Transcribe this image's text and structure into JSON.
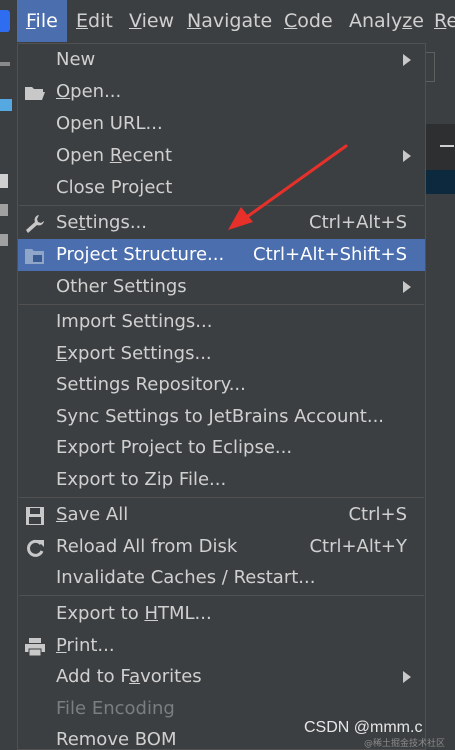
{
  "menubar": {
    "items": [
      {
        "id": "file",
        "mnemonic": "F",
        "rest": "ile"
      },
      {
        "id": "edit",
        "mnemonic": "E",
        "rest": "dit"
      },
      {
        "id": "view",
        "mnemonic": "V",
        "rest": "iew"
      },
      {
        "id": "navigate",
        "mnemonic": "N",
        "rest": "avigate"
      },
      {
        "id": "code",
        "mnemonic": "C",
        "rest": "ode"
      },
      {
        "id": "analyze",
        "pre": "Analy",
        "mnemonic": "z",
        "rest": "e"
      },
      {
        "id": "refactor",
        "mnemonic": "R",
        "rest": "e"
      }
    ],
    "active": "file"
  },
  "file_menu": {
    "items": [
      {
        "label": "New",
        "submenu": true
      },
      {
        "label": "Open...",
        "icon": "folder-open-icon"
      },
      {
        "label": "Open URL..."
      },
      {
        "label": "Open Recent",
        "submenu": true
      },
      {
        "label": "Close Project"
      },
      {
        "label": "Settings...",
        "shortcut": "Ctrl+Alt+S",
        "icon": "wrench-icon"
      },
      {
        "label": "Project Structure...",
        "shortcut": "Ctrl+Alt+Shift+S",
        "icon": "project-structure-icon",
        "selected": true
      },
      {
        "label": "Other Settings",
        "submenu": true
      },
      {
        "label": "Import Settings..."
      },
      {
        "label": "Export Settings..."
      },
      {
        "label": "Settings Repository..."
      },
      {
        "label": "Sync Settings to JetBrains Account..."
      },
      {
        "label": "Export Project to Eclipse..."
      },
      {
        "label": "Export to Zip File..."
      },
      {
        "label": "Save All",
        "shortcut": "Ctrl+S",
        "icon": "save-icon"
      },
      {
        "label": "Reload All from Disk",
        "shortcut": "Ctrl+Alt+Y",
        "icon": "reload-icon"
      },
      {
        "label": "Invalidate Caches / Restart..."
      },
      {
        "label": "Export to HTML..."
      },
      {
        "label": "Print...",
        "icon": "printer-icon"
      },
      {
        "label": "Add to Favorites",
        "submenu": true
      },
      {
        "label": "File Encoding",
        "disabled": true
      },
      {
        "label": "Remove BOM"
      }
    ]
  },
  "annotation": {
    "color": "#e8302a"
  },
  "watermark": {
    "text": "CSDN @mmm.c",
    "subtext": "@稀土掘金技术社区"
  },
  "colors": {
    "selection": "#4b6eaf",
    "menu_bg": "#3c3f41",
    "text": "#d0d0d0",
    "disabled": "#7b7e80"
  }
}
